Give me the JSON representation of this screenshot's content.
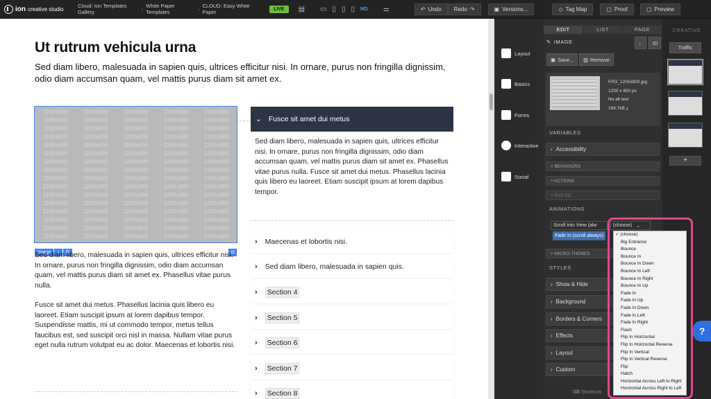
{
  "topbar": {
    "brand": "ion",
    "brand_sub": "creative studio",
    "breadcrumbs": [
      "Cloud: Ion Templates Gallery",
      "White Paper Templates",
      "CLOUD: Easy White Paper"
    ],
    "live_badge": "LIVE",
    "device_md": "MD",
    "undo": "Undo",
    "redo": "Redo",
    "versions": "Versions...",
    "tag_map": "Tag Map",
    "proof": "Proof",
    "preview": "Preview"
  },
  "page": {
    "heading": "Ut rutrum vehicula urna",
    "subheading": "Sed diam libero, malesuada in sapien quis, ultrices efficitur nisi. In ornare, purus non fringilla dignissim, odio diam accumsan quam, vel mattis purus diam sit amet ex.",
    "image_placeholder": "1200x800",
    "image_tag": "Image",
    "para1": "Sed diam libero, malesuada in sapien quis, ultrices efficitur nisi. In ornare, purus non fringilla dignissim, odio diam accumsan quam, vel mattis purus diam sit amet ex. Phasellus vitae purus nulla.",
    "para2": "Fusce sit amet dui metus. Phasellus lacinia quis libero eu laoreet. Etiam suscipit ipsum at lorem dapibus tempor. Suspendisse mattis, mi ut commodo tempor, metus tellus faucibus est, sed suscipit orci nisl in massa. Nullam vitae purus eget nulla rutrum volutpat eu ac dolor. Maecenas et lobortis nisi.",
    "accordion_open_title": "Fusce sit amet dui metus",
    "accordion_open_body": "Sed diam libero, malesuada in sapien quis, ultrices efficitur nisi. In ornare, purus non fringilla dignissim, odio diam accumsan quam, vel mattis purus diam sit amet ex. Phasellus vitae purus nulla. Fusce sit amet dui metus. Phasellus lacinia quis libero eu laoreet. Etiam suscipit ipsum at lorem dapibus tempor.",
    "accordion_items": [
      "Maecenas et lobortis nisi.",
      "Sed diam libero, malesuada in sapien quis.",
      "Section 4",
      "Section 5",
      "Section 6",
      "Section 7",
      "Section 8"
    ]
  },
  "tools": {
    "items": [
      "Layout",
      "Basics",
      "Forms",
      "Interactive",
      "Social"
    ]
  },
  "editor": {
    "tabs": [
      "EDIT",
      "LIST",
      "PAGE"
    ],
    "section_title": "IMAGE",
    "id_label": "ID",
    "save": "Save...",
    "remove": "Remove",
    "file_name": "FPO_1200x800.jpg",
    "file_dims": "1200 x 800 px",
    "file_alt": "No alt text",
    "file_size": "196.7kB",
    "variables": "VARIABLES",
    "accessibility": "Accessibility",
    "behaviors": "+ BEHAVIORS",
    "actions": "+ ACTIONS",
    "rich_ed": "+ Rich ED",
    "animations": "ANIMATIONS",
    "trigger_select": "Scroll into View (alw",
    "effect_select": "(choose)",
    "applied_chip": "Fade In (scroll always)",
    "micro_themes": "+ MICRO-THEMES",
    "styles": "STYLES",
    "style_rows": [
      "Show & Hide",
      "Background",
      "Borders & Corners",
      "Effects",
      "Layout",
      "Custom"
    ],
    "shortcuts": "Shortcuts"
  },
  "dropdown": {
    "options": [
      "(choose)",
      "Big Entrance",
      "Bounce",
      "Bounce In",
      "Bounce In Down",
      "Bounce In Left",
      "Bounce In Right",
      "Bounce In Up",
      "Fade In",
      "Fade In Up",
      "Fade In Down",
      "Fade In Left",
      "Fade In Right",
      "Flash",
      "Flip In Horizontal",
      "Flip In Horizontal Reverse",
      "Flip In Vertical",
      "Flip In Vertical Reverse",
      "Flip",
      "Hatch",
      "Horizontal Across Left to Right",
      "Horizontal Across Right to Left"
    ],
    "selected": "(choose)"
  },
  "creative": {
    "title": "CREATIVE",
    "traffic": "Traffic",
    "add": "+"
  },
  "colors": {
    "accent": "#3b82f6",
    "accordion_header": "#2d3444",
    "live_badge": "#6fbf3a",
    "highlight": "#e6458d",
    "help": "#2f6fde"
  }
}
